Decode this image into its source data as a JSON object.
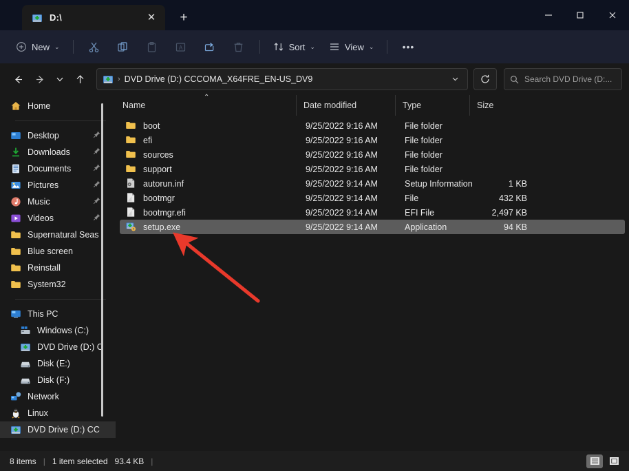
{
  "window": {
    "tab_title": "D:\\",
    "tab_icon": "dvd-drive-icon",
    "new_tab_label": "+",
    "close_tab_label": "✕",
    "minimize_label": "—",
    "maximize_label": "☐",
    "close_label": "✕"
  },
  "toolbar": {
    "new_label": "New",
    "new_chevron": "⌄",
    "cut_icon": "scissors-icon",
    "copy_icon": "copy-icon",
    "paste_icon": "paste-icon",
    "rename_icon": "rename-icon",
    "share_icon": "share-icon",
    "delete_icon": "trash-icon",
    "sort_label": "Sort",
    "sort_chevron": "⌄",
    "view_label": "View",
    "view_chevron": "⌄",
    "more_label": "•••"
  },
  "navbar": {
    "back_icon": "←",
    "forward_icon": "→",
    "recent_icon": "⌄",
    "up_icon": "↑",
    "breadcrumb_sep": "›",
    "breadcrumb_text": "DVD Drive (D:) CCCOMA_X64FRE_EN-US_DV9",
    "address_chevron": "⌄",
    "refresh_icon": "⟳",
    "search_placeholder": "Search DVD Drive (D:..."
  },
  "sidebar": {
    "home": {
      "label": "Home",
      "icon": "home-icon"
    },
    "pinned": [
      {
        "label": "Desktop",
        "icon": "desktop-icon",
        "pinned": true
      },
      {
        "label": "Downloads",
        "icon": "downloads-icon",
        "pinned": true
      },
      {
        "label": "Documents",
        "icon": "documents-icon",
        "pinned": true
      },
      {
        "label": "Pictures",
        "icon": "pictures-icon",
        "pinned": true
      },
      {
        "label": "Music",
        "icon": "music-icon",
        "pinned": true
      },
      {
        "label": "Videos",
        "icon": "videos-icon",
        "pinned": true
      },
      {
        "label": "Supernatural Seas",
        "icon": "folder-icon",
        "pinned": false
      },
      {
        "label": "Blue screen",
        "icon": "folder-icon",
        "pinned": false
      },
      {
        "label": "Reinstall",
        "icon": "folder-icon",
        "pinned": false
      },
      {
        "label": "System32",
        "icon": "folder-icon",
        "pinned": false
      }
    ],
    "this_pc": {
      "label": "This PC",
      "icon": "this-pc-icon"
    },
    "drives": [
      {
        "label": "Windows (C:)",
        "icon": "windows-drive-icon"
      },
      {
        "label": "DVD Drive (D:) C",
        "icon": "dvd-drive-icon"
      },
      {
        "label": "Disk (E:)",
        "icon": "drive-icon"
      },
      {
        "label": "Disk (F:)",
        "icon": "drive-icon"
      }
    ],
    "network": {
      "label": "Network",
      "icon": "network-icon"
    },
    "linux": {
      "label": "Linux",
      "icon": "linux-icon"
    },
    "selected_drive": {
      "label": "DVD Drive (D:) CC",
      "icon": "dvd-drive-icon"
    }
  },
  "file_list": {
    "columns": {
      "name": "Name",
      "date_modified": "Date modified",
      "type": "Type",
      "size": "Size",
      "sort_indicator": "⌃"
    },
    "rows": [
      {
        "name": "boot",
        "date": "9/25/2022 9:16 AM",
        "type": "File folder",
        "size": "",
        "icon": "folder-icon",
        "selected": false
      },
      {
        "name": "efi",
        "date": "9/25/2022 9:16 AM",
        "type": "File folder",
        "size": "",
        "icon": "folder-icon",
        "selected": false
      },
      {
        "name": "sources",
        "date": "9/25/2022 9:16 AM",
        "type": "File folder",
        "size": "",
        "icon": "folder-icon",
        "selected": false
      },
      {
        "name": "support",
        "date": "9/25/2022 9:16 AM",
        "type": "File folder",
        "size": "",
        "icon": "folder-icon",
        "selected": false
      },
      {
        "name": "autorun.inf",
        "date": "9/25/2022 9:14 AM",
        "type": "Setup Information",
        "size": "1 KB",
        "icon": "inf-file-icon",
        "selected": false
      },
      {
        "name": "bootmgr",
        "date": "9/25/2022 9:14 AM",
        "type": "File",
        "size": "432 KB",
        "icon": "file-icon",
        "selected": false
      },
      {
        "name": "bootmgr.efi",
        "date": "9/25/2022 9:14 AM",
        "type": "EFI File",
        "size": "2,497 KB",
        "icon": "file-icon",
        "selected": false
      },
      {
        "name": "setup.exe",
        "date": "9/25/2022 9:14 AM",
        "type": "Application",
        "size": "94 KB",
        "icon": "setup-exe-icon",
        "selected": true
      }
    ]
  },
  "statusbar": {
    "item_count": "8 items",
    "separator": "|",
    "selection": "1 item selected",
    "selection_size": "93.4 KB",
    "separator2": "|",
    "details_view_icon": "details-view-icon",
    "large_icons_view_icon": "large-icons-view-icon"
  },
  "annotation": {
    "arrow_color": "#e8392b",
    "arrow_from": "375,437",
    "arrow_to": "263,347"
  }
}
